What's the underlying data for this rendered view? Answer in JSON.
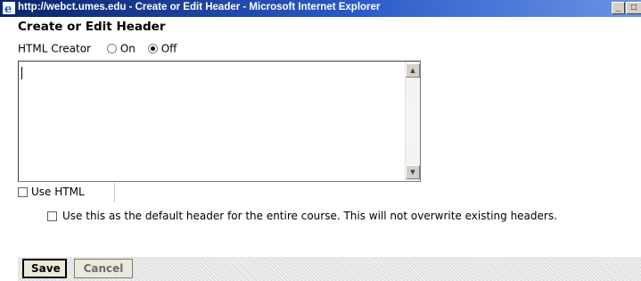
{
  "window": {
    "title": "http://webct.umes.edu - Create or Edit Header - Microsoft Internet Explorer",
    "minimize_glyph": "_",
    "maximize_glyph": "□",
    "icon": "ie-icon"
  },
  "form": {
    "heading": "Create or Edit Header",
    "html_creator": {
      "label": "HTML Creator",
      "options": [
        {
          "label": "On",
          "selected": false
        },
        {
          "label": "Off",
          "selected": true
        }
      ]
    },
    "editor_value": "",
    "use_html_label": "Use HTML",
    "use_html_checked": false,
    "default_header_label": "Use this as the default header for the entire course. This will not overwrite existing headers.",
    "default_header_checked": false
  },
  "buttons": {
    "save_label": "Save",
    "cancel_label": "Cancel"
  },
  "colors": {
    "titlebar_start": "#0a246a",
    "titlebar_end": "#6a94e4"
  }
}
